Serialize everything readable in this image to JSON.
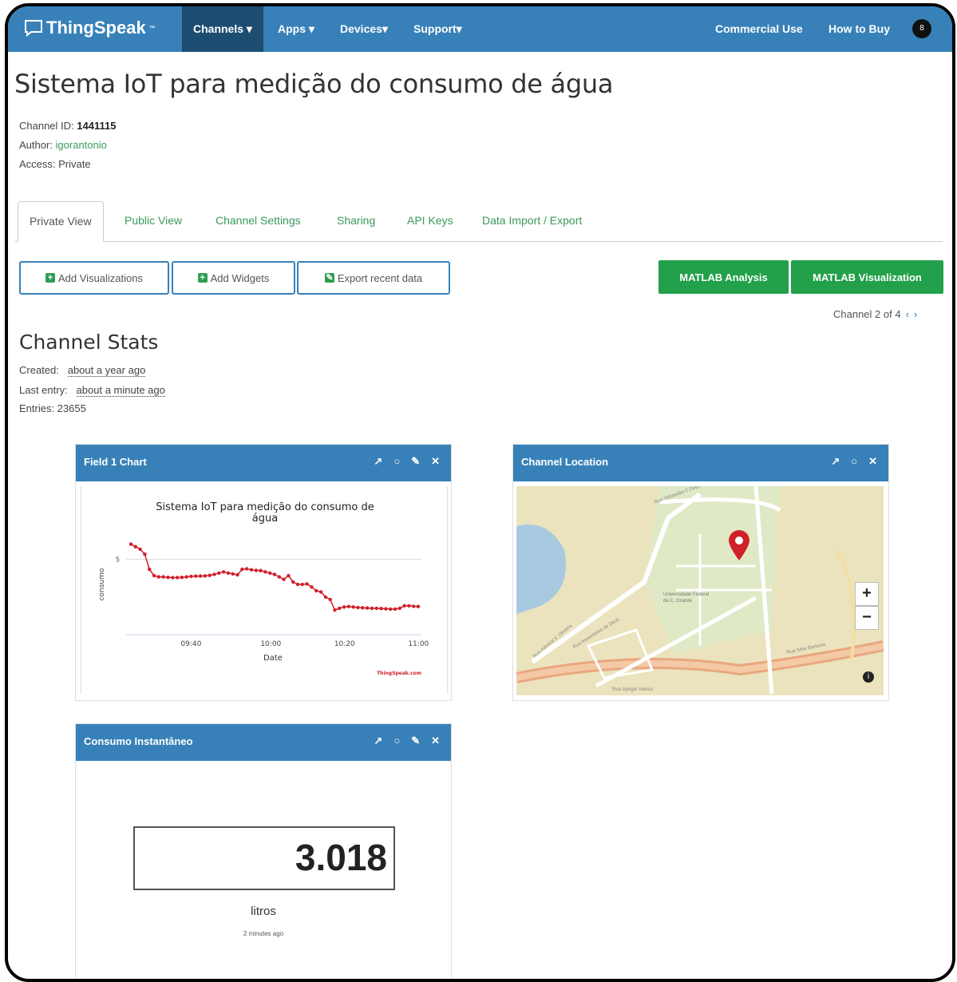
{
  "nav": {
    "logo": "ThingSpeak",
    "logo_tm": "™",
    "items": [
      "Channels ▾",
      "Apps ▾",
      "Devices▾",
      "Support▾"
    ],
    "right": [
      "Commercial Use",
      "How to Buy"
    ],
    "avatar": "8"
  },
  "page": {
    "title": "Sistema IoT para medição do consumo de água",
    "channel_id_label": "Channel ID:",
    "channel_id": "1441115",
    "author_label": "Author:",
    "author": "igorantonio",
    "access": "Access: Private"
  },
  "tabs": [
    "Private View",
    "Public View",
    "Channel Settings",
    "Sharing",
    "API Keys",
    "Data Import / Export"
  ],
  "buttons": {
    "add_visualizations": "Add Visualizations",
    "add_widgets": "Add Widgets",
    "export_recent": "Export recent data",
    "matlab_analysis": "MATLAB Analysis",
    "matlab_visualization": "MATLAB Visualization"
  },
  "channel_nav": "Channel 2 of 4",
  "stats": {
    "title": "Channel Stats",
    "created_label": "Created:",
    "created": "about a year ago",
    "last_entry_label": "Last entry:",
    "last_entry": "about a minute ago",
    "entries": "Entries: 23655"
  },
  "widgets": {
    "field1_title": "Field 1 Chart",
    "location_title": "Channel Location",
    "gauge_title": "Consumo Instantâneo",
    "gauge_value": "3.018",
    "gauge_unit": "litros",
    "gauge_time": "2 minutes ago"
  },
  "map": {
    "campus_label": "Universidade Federal de C. Grande",
    "streets": [
      "Rua Sebastião C.Delphino",
      "Rua Silva Barbosa",
      "Rua Admiral V. Oliveira",
      "Rua Assembleia de Deus",
      "Rua Aprígio Veloso"
    ]
  },
  "chart_data": {
    "type": "line",
    "title": "Sistema IoT para medição do consumo de água",
    "xlabel": "Date",
    "ylabel": "consumo",
    "credit": "ThingSpeak.com",
    "x_ticks": [
      "09:40",
      "10:00",
      "10:20",
      "11:00"
    ],
    "y_ticks": [
      "5"
    ],
    "ylim": [
      2,
      6
    ],
    "color": "#d0202a",
    "y": [
      5.6,
      5.5,
      5.4,
      5.2,
      4.6,
      4.35,
      4.3,
      4.3,
      4.28,
      4.27,
      4.27,
      4.28,
      4.3,
      4.32,
      4.33,
      4.33,
      4.34,
      4.36,
      4.4,
      4.45,
      4.5,
      4.45,
      4.42,
      4.38,
      4.6,
      4.62,
      4.58,
      4.56,
      4.55,
      4.5,
      4.45,
      4.4,
      4.3,
      4.2,
      4.35,
      4.1,
      4.0,
      4.0,
      4.02,
      3.9,
      3.75,
      3.7,
      3.5,
      3.4,
      2.98,
      3.05,
      3.1,
      3.12,
      3.1,
      3.08,
      3.07,
      3.06,
      3.05,
      3.05,
      3.04,
      3.03,
      3.02,
      3.02,
      3.05,
      3.15,
      3.15,
      3.13,
      3.12
    ]
  }
}
